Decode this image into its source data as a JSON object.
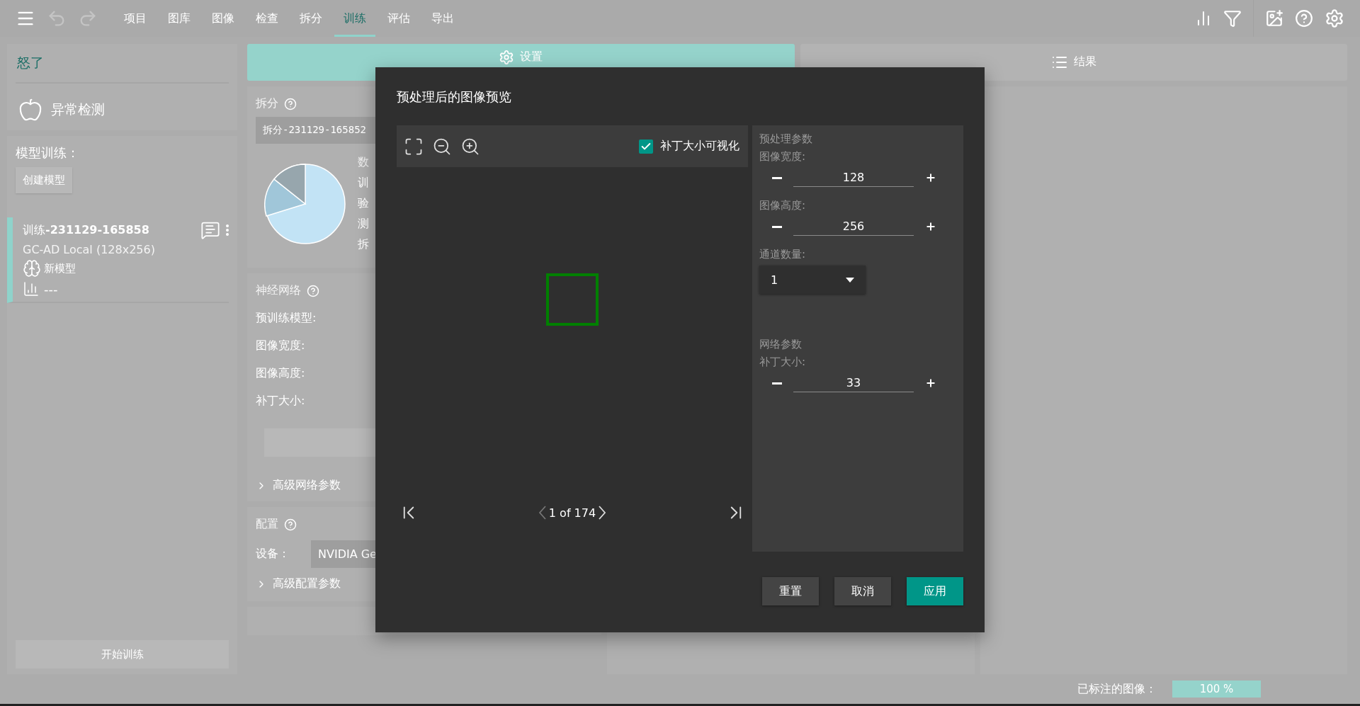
{
  "menu_bar": {
    "undo_disabled": true,
    "redo_disabled": true,
    "items": [
      {
        "label": "项目",
        "selected": false
      },
      {
        "label": "图库",
        "selected": false
      },
      {
        "label": "图像",
        "selected": false
      },
      {
        "label": "检查",
        "selected": false
      },
      {
        "label": "拆分",
        "selected": false
      },
      {
        "label": "训练",
        "selected": true
      },
      {
        "label": "评估",
        "selected": false
      },
      {
        "label": "导出",
        "selected": false
      }
    ]
  },
  "left_panel": {
    "project": "怒了",
    "method": "异常检测",
    "section_label": "模型训练：",
    "create_button": "创建模型",
    "trainings": [
      {
        "name": "训练**-231129-165858**",
        "subtitle": "GC-AD Local (128x256)",
        "model": "新模型",
        "result": "---",
        "selected": true
      }
    ],
    "start_button": "开始训练"
  },
  "view_tabs": [
    {
      "label": "设置",
      "selected": true
    },
    {
      "label": "结果",
      "selected": false
    }
  ],
  "split_card": {
    "title": "拆分",
    "value": "拆分-231129-165852",
    "legend": [
      "数",
      "训",
      "验",
      "测",
      "拆"
    ]
  },
  "network_card": {
    "title": "神经网络",
    "fields": [
      "预训练模型:",
      "图像宽度:",
      "图像高度:",
      "补丁大小:"
    ],
    "advanced": "高级网络参数"
  },
  "config_card": {
    "title": "配置",
    "device_label": "设备：",
    "device_value": "NVIDIA Ge",
    "advanced": "高级配置参数"
  },
  "status_bar": {
    "label": "已标注的图像：",
    "level": 1,
    "reading": "100 %"
  },
  "dialog": {
    "title": "预处理后的图像预览",
    "patch_visualization": {
      "label": "补丁大小可视化",
      "checked": true
    },
    "pager": "1 of 174",
    "nav": [
      {
        "kind": "first",
        "disabled": false
      },
      {
        "kind": "prev",
        "disabled": true
      },
      {
        "kind": "next",
        "disabled": false
      },
      {
        "kind": "last",
        "disabled": false
      }
    ],
    "preprocessing": {
      "title": "预处理参数",
      "fields": [
        {
          "kind": "spin",
          "label": "图像宽度:",
          "value": "128"
        },
        {
          "kind": "spin",
          "label": "图像高度:",
          "value": "256"
        },
        {
          "kind": "select",
          "label": "通道数量:",
          "value": "1"
        }
      ]
    },
    "network": {
      "title": "网络参数",
      "fields": [
        {
          "kind": "spin",
          "label": "补丁大小:",
          "value": "33"
        }
      ]
    },
    "buttons": [
      {
        "label": "重置",
        "primary": false
      },
      {
        "label": "取消",
        "primary": false
      },
      {
        "label": "应用",
        "primary": true
      }
    ]
  }
}
